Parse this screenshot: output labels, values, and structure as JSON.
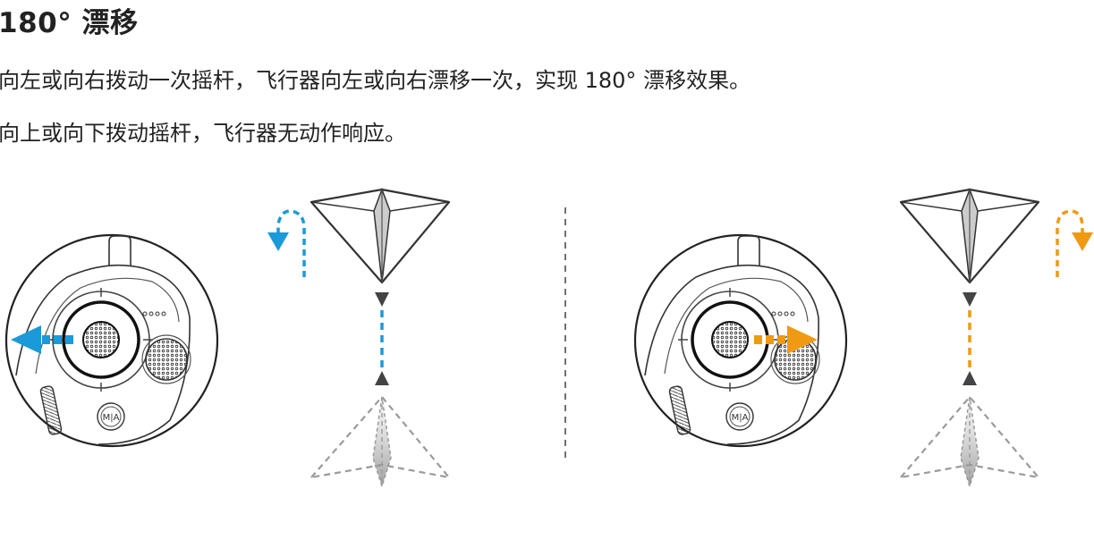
{
  "header": {
    "title": "180° 漂移"
  },
  "body": {
    "line1": "向左或向右拨动一次摇杆，飞行器向左或向右漂移一次，实现 180°  漂移效果。",
    "line2": "向上或向下拨动摇杆，飞行器无动作响应。"
  },
  "controller": {
    "mode_label": "M|A"
  },
  "colors": {
    "left_arrow": "#1a9ad8",
    "right_arrow": "#ef9a12",
    "stroke": "#333333",
    "dashed_gray": "#9a9a9a"
  }
}
